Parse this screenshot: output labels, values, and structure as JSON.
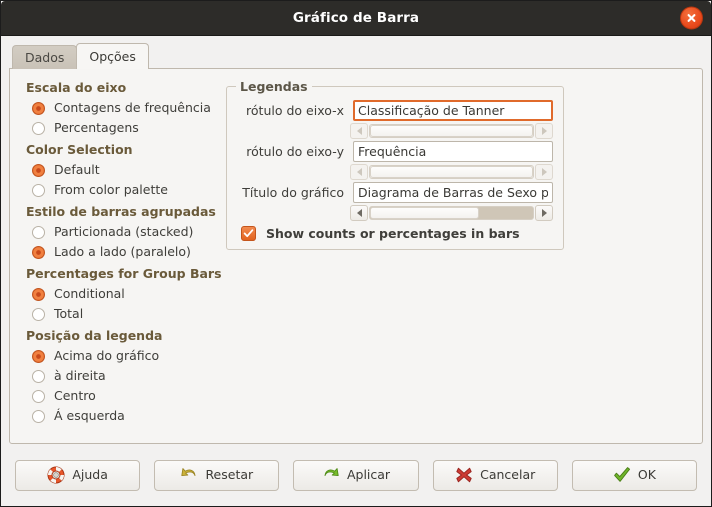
{
  "window": {
    "title": "Gráfico de Barra",
    "close_icon": "close-x-icon"
  },
  "tabs": [
    {
      "label": "Dados",
      "active": false
    },
    {
      "label": "Opções",
      "active": true
    }
  ],
  "options": {
    "groups": [
      {
        "heading": "Escala do eixo",
        "items": [
          {
            "label": "Contagens de frequência",
            "checked": true
          },
          {
            "label": "Percentagens",
            "checked": false
          }
        ]
      },
      {
        "heading": "Color Selection",
        "items": [
          {
            "label": "Default",
            "checked": true
          },
          {
            "label": "From color palette",
            "checked": false
          }
        ]
      },
      {
        "heading": "Estilo de barras agrupadas",
        "items": [
          {
            "label": "Particionada (stacked)",
            "checked": false
          },
          {
            "label": "Lado a lado (paralelo)",
            "checked": true
          }
        ]
      },
      {
        "heading": "Percentages for Group Bars",
        "items": [
          {
            "label": "Conditional",
            "checked": true
          },
          {
            "label": "Total",
            "checked": false
          }
        ]
      },
      {
        "heading": "Posição da legenda",
        "items": [
          {
            "label": "Acima do gráfico",
            "checked": true
          },
          {
            "label": "à direita",
            "checked": false
          },
          {
            "label": "Centro",
            "checked": false
          },
          {
            "label": "Á esquerda",
            "checked": false
          }
        ]
      }
    ]
  },
  "legends": {
    "title": "Legendas",
    "fields": [
      {
        "label": "rótulo do eixo-x",
        "value": "Classificação de Tanner",
        "focused": true,
        "scrollbar": {
          "thumb_percent": 100,
          "thumb_offset_percent": 0,
          "enabled": false
        }
      },
      {
        "label": "rótulo do eixo-y",
        "value": "Frequência",
        "focused": false,
        "scrollbar": {
          "thumb_percent": 100,
          "thumb_offset_percent": 0,
          "enabled": false
        }
      },
      {
        "label": "Título do gráfico",
        "value": "Diagrama de Barras de Sexo por",
        "focused": false,
        "scrollbar": {
          "thumb_percent": 67,
          "thumb_offset_percent": 0,
          "enabled": true
        }
      }
    ],
    "checkbox": {
      "label": "Show counts or percentages in bars",
      "checked": true
    }
  },
  "buttons": [
    {
      "label": "Ajuda",
      "icon": "lifebuoy-icon"
    },
    {
      "label": "Resetar",
      "icon": "undo-arrow-icon"
    },
    {
      "label": "Aplicar",
      "icon": "redo-arrow-icon"
    },
    {
      "label": "Cancelar",
      "icon": "red-x-icon"
    },
    {
      "label": "OK",
      "icon": "green-check-icon"
    }
  ],
  "colors": {
    "accent_orange": "#e2631f",
    "titlebar": "#2d2c29",
    "panel": "#f6f5f3",
    "heading_text": "#6a5a3a"
  }
}
